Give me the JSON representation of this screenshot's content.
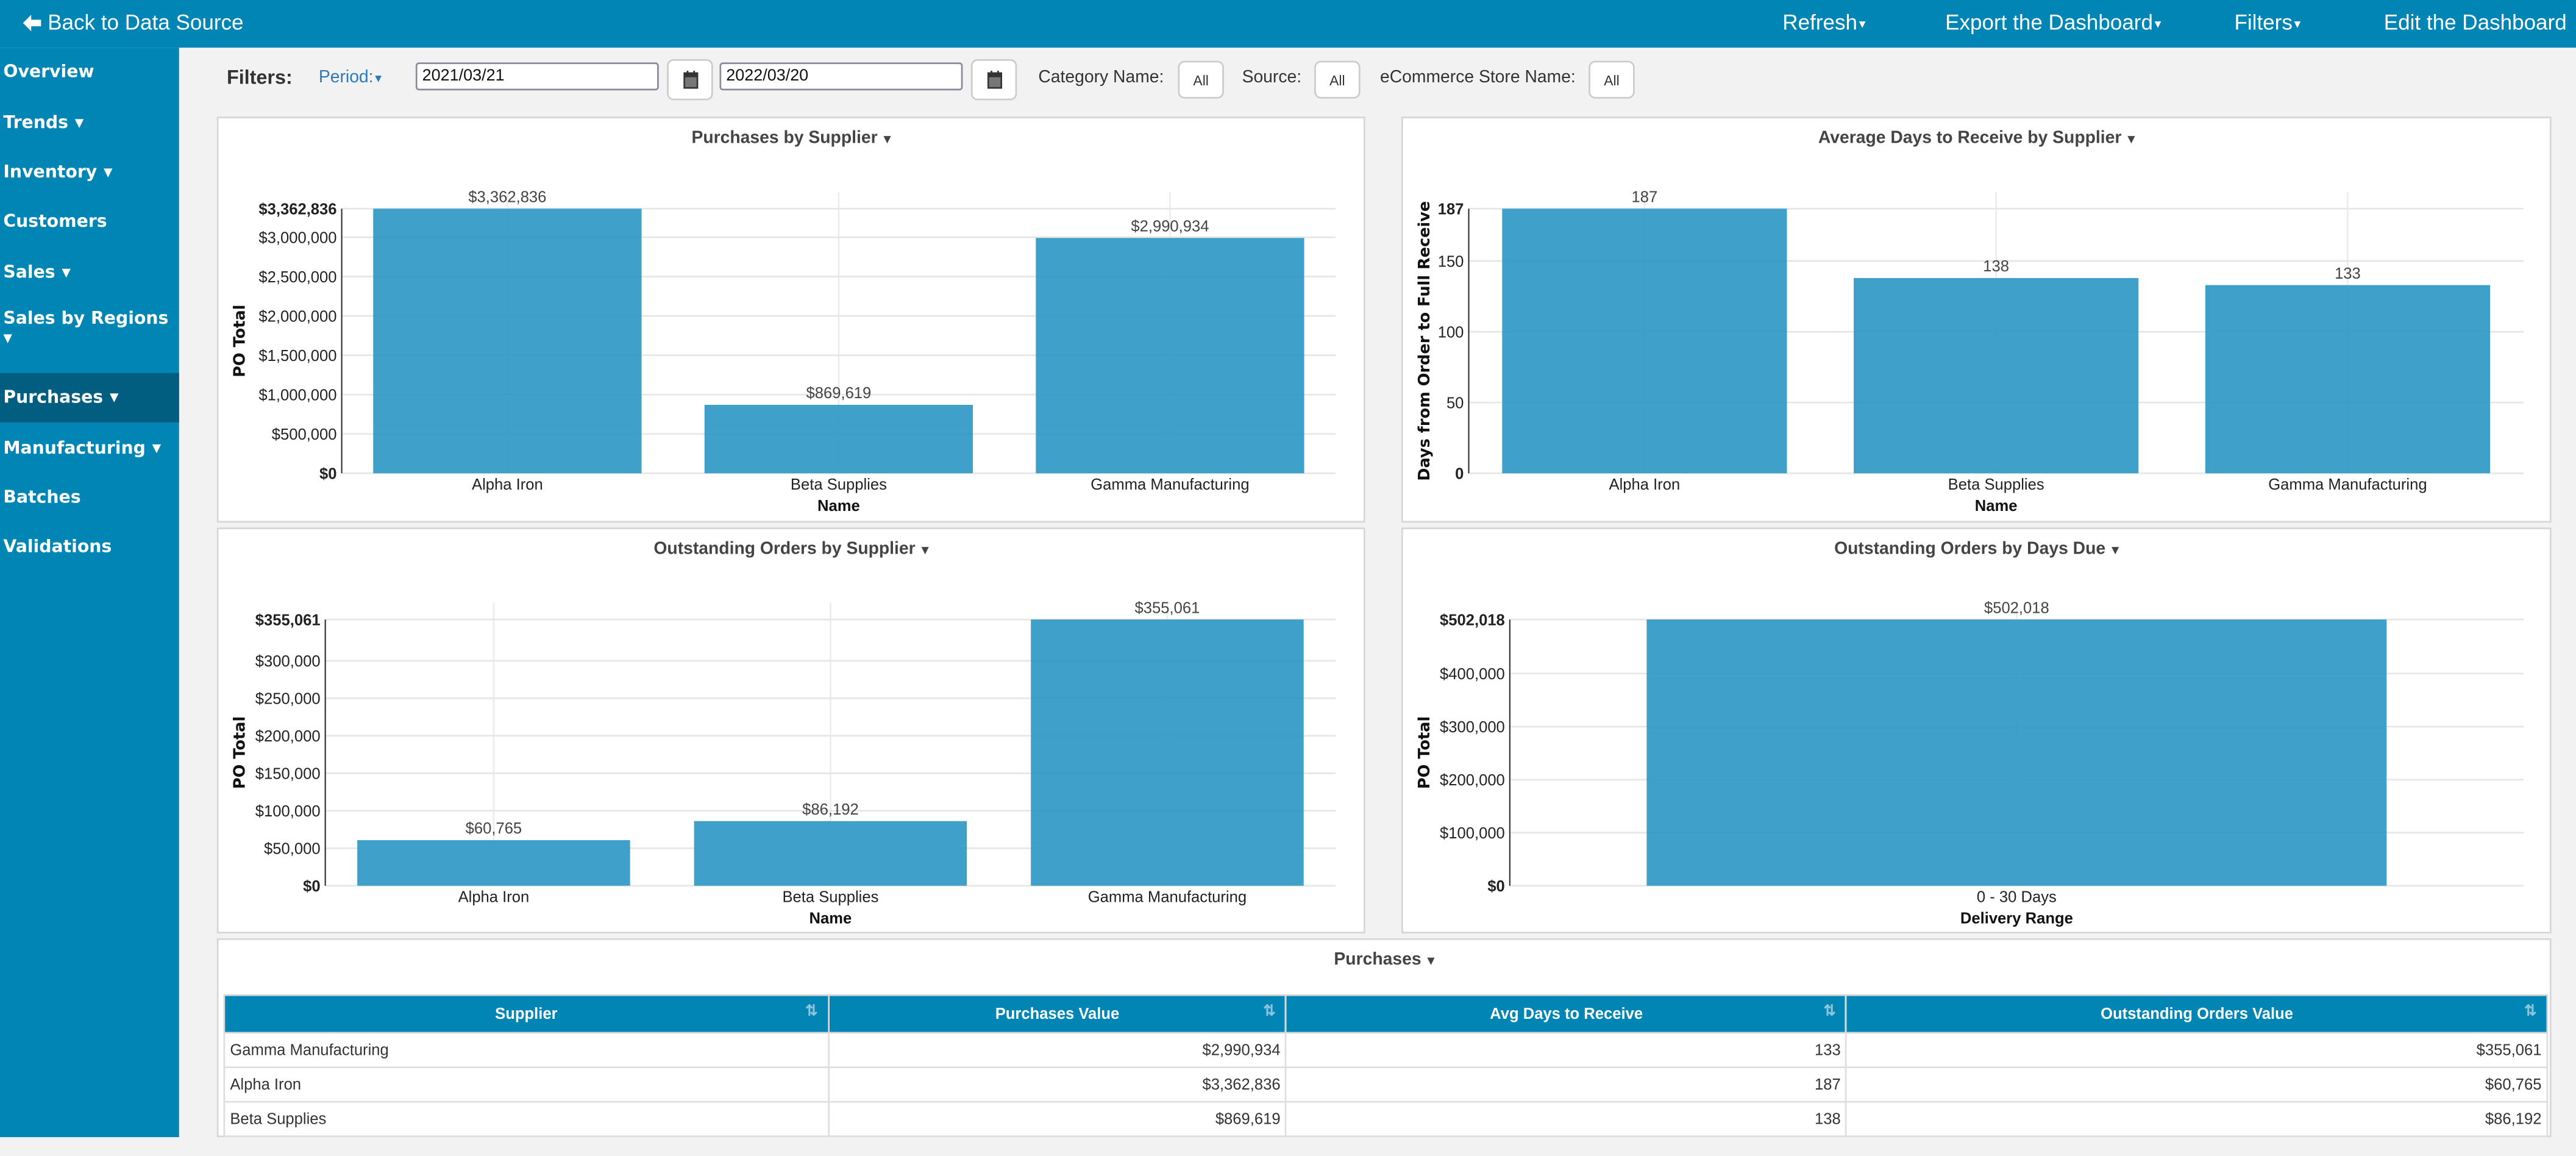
{
  "topbar": {
    "back_label": "Back to Data Source",
    "menus": [
      {
        "label": "Refresh",
        "has_caret": true
      },
      {
        "label": "Export the Dashboard",
        "has_caret": true
      },
      {
        "label": "Filters",
        "has_caret": true
      },
      {
        "label": "Edit the Dashboard",
        "has_caret": false
      }
    ]
  },
  "sidebar": {
    "active": "Purchases",
    "items": [
      {
        "label": "Overview",
        "has_caret": false
      },
      {
        "label": "Trends",
        "has_caret": true
      },
      {
        "label": "Inventory",
        "has_caret": true
      },
      {
        "label": "Customers",
        "has_caret": false
      },
      {
        "label": "Sales",
        "has_caret": true
      },
      {
        "label": "Sales by Regions",
        "has_caret": true
      },
      {
        "label": "Purchases",
        "has_caret": true
      },
      {
        "label": "Manufacturing",
        "has_caret": true
      },
      {
        "label": "Batches",
        "has_caret": false
      },
      {
        "label": "Validations",
        "has_caret": false
      }
    ]
  },
  "filters": {
    "label": "Filters:",
    "period_label": "Period:",
    "start_date": "2021/03/21",
    "end_date": "2022/03/20",
    "category_label": "Category Name:",
    "category_value": "All",
    "source_label": "Source:",
    "source_value": "All",
    "store_label": "eCommerce Store Name:",
    "store_value": "All"
  },
  "colors": {
    "brand": "#0085b5",
    "sidebar_active": "#015e80",
    "bar": "#2f98c4"
  },
  "chart_data": [
    {
      "id": "purchases-by-supplier",
      "type": "bar",
      "title": "Purchases by Supplier",
      "xlabel": "Name",
      "ylabel": "PO Total",
      "categories": [
        "Alpha Iron",
        "Beta Supplies",
        "Gamma Manufacturing"
      ],
      "values": [
        3362836,
        869619,
        2990934
      ],
      "value_labels": [
        "$3,362,836",
        "$869,619",
        "$2,990,934"
      ],
      "ylim": [
        0,
        3362836
      ],
      "yticks": [
        0,
        500000,
        1000000,
        1500000,
        2000000,
        2500000,
        3000000,
        3362836
      ],
      "ytick_labels": [
        "$0",
        "$500,000",
        "$1,000,000",
        "$1,500,000",
        "$2,000,000",
        "$2,500,000",
        "$3,000,000",
        "$3,362,836"
      ],
      "grid": true
    },
    {
      "id": "avg-days-to-receive",
      "type": "bar",
      "title": "Average Days to Receive by Supplier",
      "xlabel": "Name",
      "ylabel": "Days from Order to Full Receive",
      "categories": [
        "Alpha Iron",
        "Beta Supplies",
        "Gamma Manufacturing"
      ],
      "values": [
        187,
        138,
        133
      ],
      "value_labels": [
        "187",
        "138",
        "133"
      ],
      "ylim": [
        0,
        187
      ],
      "yticks": [
        0,
        50,
        100,
        150,
        187
      ],
      "ytick_labels": [
        "0",
        "50",
        "100",
        "150",
        "187"
      ],
      "grid": true
    },
    {
      "id": "outstanding-orders-by-supplier",
      "type": "bar",
      "title": "Outstanding Orders by Supplier",
      "xlabel": "Name",
      "ylabel": "PO Total",
      "categories": [
        "Alpha Iron",
        "Beta Supplies",
        "Gamma Manufacturing"
      ],
      "values": [
        60765,
        86192,
        355061
      ],
      "value_labels": [
        "$60,765",
        "$86,192",
        "$355,061"
      ],
      "ylim": [
        0,
        355061
      ],
      "yticks": [
        0,
        50000,
        100000,
        150000,
        200000,
        250000,
        300000,
        355061
      ],
      "ytick_labels": [
        "$0",
        "$50,000",
        "$100,000",
        "$150,000",
        "$200,000",
        "$250,000",
        "$300,000",
        "$355,061"
      ],
      "grid": true
    },
    {
      "id": "outstanding-orders-by-days-due",
      "type": "bar",
      "title": "Outstanding Orders by Days Due",
      "xlabel": "Delivery Range",
      "ylabel": "PO Total",
      "categories": [
        "0 - 30 Days"
      ],
      "values": [
        502018
      ],
      "value_labels": [
        "$502,018"
      ],
      "ylim": [
        0,
        502018
      ],
      "yticks": [
        0,
        100000,
        200000,
        300000,
        400000,
        502018
      ],
      "ytick_labels": [
        "$0",
        "$100,000",
        "$200,000",
        "$300,000",
        "$400,000",
        "$502,018"
      ],
      "grid": true
    }
  ],
  "table": {
    "title": "Purchases",
    "columns": [
      "Supplier",
      "Purchases Value",
      "Avg Days to Receive",
      "Outstanding Orders Value"
    ],
    "rows": [
      [
        "Gamma Manufacturing",
        "$2,990,934",
        "133",
        "$355,061"
      ],
      [
        "Alpha Iron",
        "$3,362,836",
        "187",
        "$60,765"
      ],
      [
        "Beta Supplies",
        "$869,619",
        "138",
        "$86,192"
      ]
    ]
  }
}
